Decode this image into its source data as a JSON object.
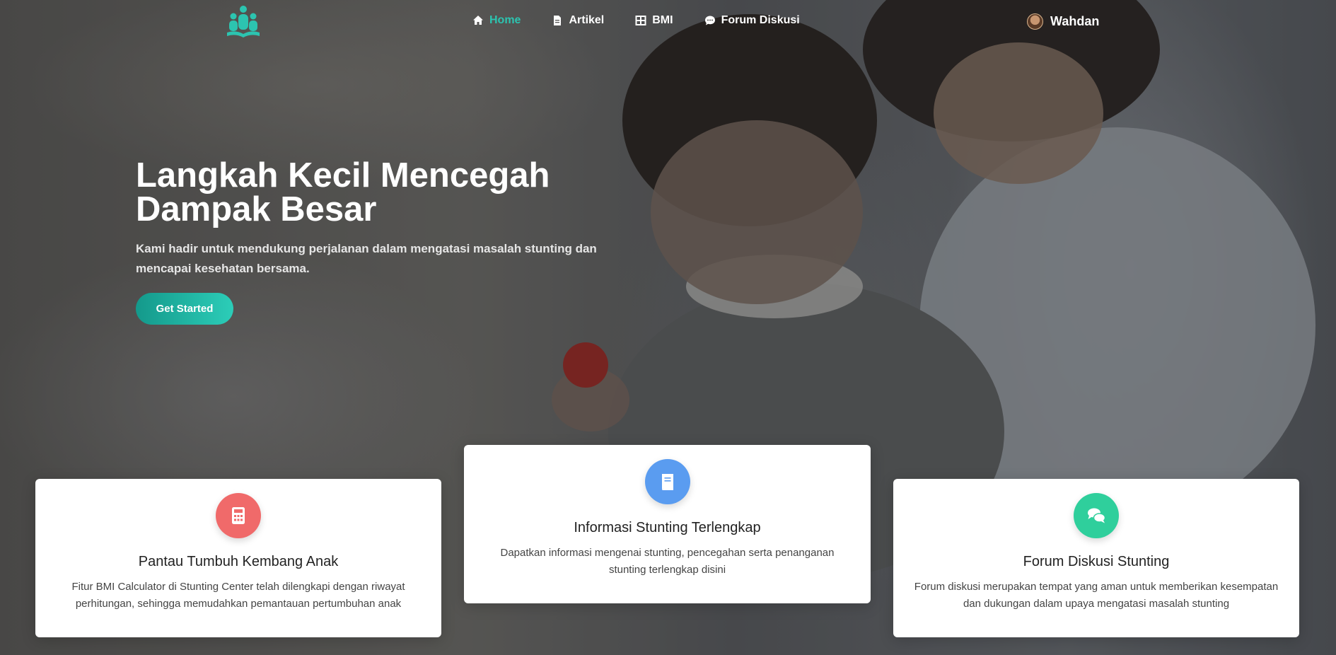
{
  "nav": {
    "items": [
      {
        "label": "Home",
        "icon": "home-icon"
      },
      {
        "label": "Artikel",
        "icon": "file-icon"
      },
      {
        "label": "BMI",
        "icon": "table-icon"
      },
      {
        "label": "Forum Diskusi",
        "icon": "chat-icon"
      }
    ],
    "user": "Wahdan"
  },
  "hero": {
    "title_line1": "Langkah Kecil Mencegah",
    "title_line2": "Dampak Besar",
    "subtitle": "Kami hadir untuk mendukung perjalanan dalam mengatasi masalah stunting dan mencapai kesehatan bersama.",
    "cta": "Get Started"
  },
  "cards": [
    {
      "title": "Pantau Tumbuh Kembang Anak",
      "text": "Fitur BMI Calculator di Stunting Center telah dilengkapi dengan riwayat perhitungan, sehingga memudahkan pemantauan pertumbuhan anak",
      "icon": "calculator-icon",
      "color": "#f06a6a"
    },
    {
      "title": "Informasi Stunting Terlengkap",
      "text": "Dapatkan informasi mengenai stunting, pencegahan serta penanganan stunting terlengkap disini",
      "icon": "book-icon",
      "color": "#5a9cf0"
    },
    {
      "title": "Forum Diskusi Stunting",
      "text": "Forum diskusi merupakan tempat yang aman untuk memberikan kesempatan dan dukungan dalam upaya mengatasi masalah stunting",
      "icon": "comments-icon",
      "color": "#2fcf9c"
    }
  ],
  "colors": {
    "accent": "#2cc4b0"
  }
}
